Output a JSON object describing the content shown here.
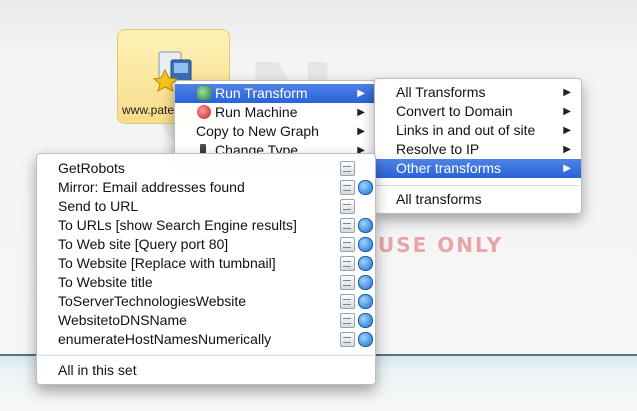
{
  "canvas": {
    "node_label": "www.pate",
    "watermark_text": "USE ONLY",
    "watermark_top_text": "UN"
  },
  "context_menu": {
    "items": [
      {
        "label": "Run Transform",
        "icon": "run-transform-icon",
        "has_submenu": true,
        "highlighted": true
      },
      {
        "label": "Run Machine",
        "icon": "run-machine-icon",
        "has_submenu": true
      },
      {
        "label": "Copy to New Graph",
        "has_submenu": true
      },
      {
        "label": "Change Type",
        "icon": "change-type-icon",
        "has_submenu": true
      }
    ]
  },
  "transform_menu": {
    "items": [
      {
        "label": "All Transforms",
        "has_submenu": true
      },
      {
        "label": "Convert to Domain",
        "has_submenu": true
      },
      {
        "label": "Links in and out of site",
        "has_submenu": true
      },
      {
        "label": "Resolve to IP",
        "has_submenu": true
      },
      {
        "label": "Other transforms",
        "has_submenu": true,
        "highlighted": true
      }
    ],
    "footer": "All transforms"
  },
  "other_transforms_menu": {
    "items": [
      {
        "label": "GetRobots",
        "info": false
      },
      {
        "label": "Mirror: Email addresses found",
        "info": true
      },
      {
        "label": "Send to URL",
        "info": false
      },
      {
        "label": "To URLs [show Search Engine results]",
        "info": true
      },
      {
        "label": "To Web site [Query port 80]",
        "info": true
      },
      {
        "label": "To Website [Replace with tumbnail]",
        "info": true
      },
      {
        "label": "To Website title",
        "info": true
      },
      {
        "label": "ToServerTechnologiesWebsite",
        "info": true
      },
      {
        "label": "WebsitetoDNSName",
        "info": true
      },
      {
        "label": "enumerateHostNamesNumerically",
        "info": true
      }
    ],
    "footer": "All in this set"
  },
  "colors": {
    "highlight": "#2a62d8",
    "node_fill": "#f6dc8a",
    "watermark_red": "#e7a6a6"
  }
}
